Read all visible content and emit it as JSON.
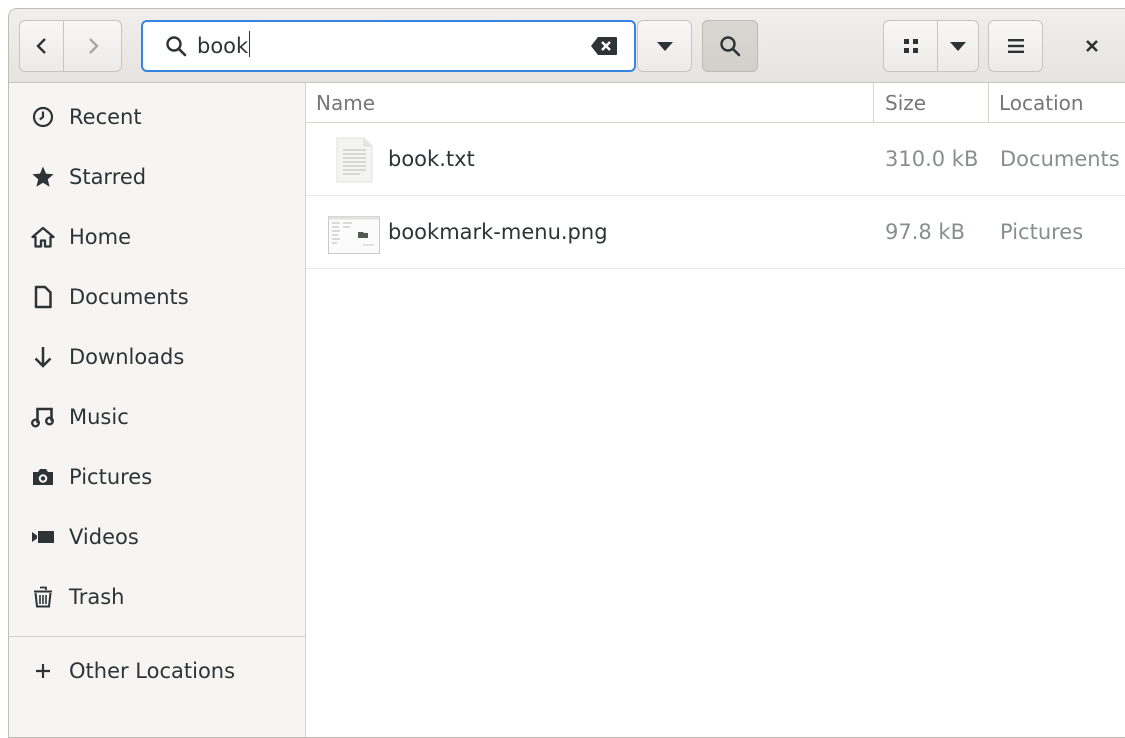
{
  "header": {
    "search": {
      "value": "book"
    },
    "icons": {
      "back": "chevron-left-icon",
      "forward": "chevron-right-icon",
      "search": "search-icon",
      "clear": "clear-backspace-icon",
      "view": "grid-view-icon",
      "menu": "hamburger-menu-icon",
      "close": "close-icon"
    }
  },
  "sidebar": {
    "items": [
      {
        "label": "Recent",
        "icon": "clock-icon"
      },
      {
        "label": "Starred",
        "icon": "star-icon"
      },
      {
        "label": "Home",
        "icon": "home-icon"
      },
      {
        "label": "Documents",
        "icon": "document-icon"
      },
      {
        "label": "Downloads",
        "icon": "download-arrow-icon"
      },
      {
        "label": "Music",
        "icon": "music-note-icon"
      },
      {
        "label": "Pictures",
        "icon": "camera-icon"
      },
      {
        "label": "Videos",
        "icon": "video-camera-icon"
      },
      {
        "label": "Trash",
        "icon": "trash-icon"
      }
    ],
    "other_locations": {
      "label": "Other Locations",
      "icon": "plus-icon"
    }
  },
  "file_list": {
    "columns": {
      "name": "Name",
      "size": "Size",
      "location": "Location"
    },
    "rows": [
      {
        "name": "book.txt",
        "size": "310.0 kB",
        "location": "Documents",
        "icon": "text-file-icon"
      },
      {
        "name": "bookmark-menu.png",
        "size": "97.8 kB",
        "location": "Pictures",
        "icon": "image-thumbnail-icon"
      }
    ]
  },
  "colors": {
    "accent": "#3584e4",
    "header_bg": "#ebe9e6",
    "sidebar_bg": "#f6f5f4",
    "secondary_text": "#8a8d8f"
  }
}
